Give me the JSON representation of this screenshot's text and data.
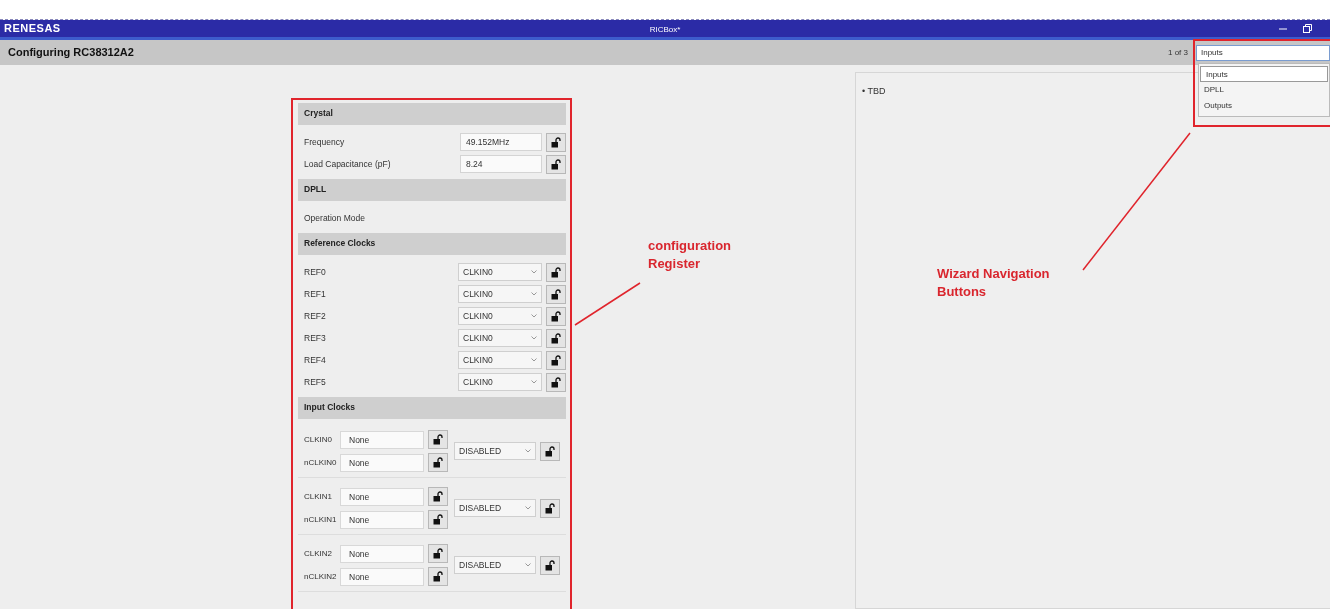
{
  "window": {
    "logo": "RENESAS",
    "title": "RICBox*"
  },
  "header": {
    "title": "Configuring RC38312A2",
    "page_indicator": "1 of 3",
    "page_select": {
      "value": "Inputs",
      "options": [
        {
          "label": "Inputs",
          "selected": true
        },
        {
          "label": "DPLL",
          "selected": false
        },
        {
          "label": "Outputs",
          "selected": false
        }
      ]
    }
  },
  "sections": [
    {
      "title": "Crystal",
      "rows": [
        {
          "kind": "field",
          "label": "Frequency",
          "value": "49.152MHz"
        },
        {
          "kind": "field",
          "label": "Load Capacitance (pF)",
          "value": "8.24"
        }
      ]
    },
    {
      "title": "DPLL",
      "rows": [
        {
          "kind": "text",
          "label": "Operation Mode"
        }
      ]
    },
    {
      "title": "Reference Clocks",
      "rows": [
        {
          "kind": "select",
          "label": "REF0",
          "value": "CLKIN0"
        },
        {
          "kind": "select",
          "label": "REF1",
          "value": "CLKIN0"
        },
        {
          "kind": "select",
          "label": "REF2",
          "value": "CLKIN0"
        },
        {
          "kind": "select",
          "label": "REF3",
          "value": "CLKIN0"
        },
        {
          "kind": "select",
          "label": "REF4",
          "value": "CLKIN0"
        },
        {
          "kind": "select",
          "label": "REF5",
          "value": "CLKIN0"
        }
      ]
    },
    {
      "title": "Input Clocks",
      "rows": [
        {
          "kind": "pair",
          "inputs": [
            {
              "label": "CLKIN0",
              "value": "None"
            },
            {
              "label": "nCLKIN0",
              "value": "None"
            }
          ],
          "mode": "DISABLED"
        },
        {
          "kind": "pair",
          "inputs": [
            {
              "label": "CLKIN1",
              "value": "None"
            },
            {
              "label": "nCLKIN1",
              "value": "None"
            }
          ],
          "mode": "DISABLED"
        },
        {
          "kind": "pair",
          "inputs": [
            {
              "label": "CLKIN2",
              "value": "None"
            },
            {
              "label": "nCLKIN2",
              "value": "None"
            }
          ],
          "mode": "DISABLED"
        }
      ]
    }
  ],
  "info_panel": {
    "items": [
      "• TBD"
    ]
  },
  "annotations": [
    {
      "text": "configuration Register"
    },
    {
      "text": "Wizard Navigation Buttons"
    }
  ]
}
